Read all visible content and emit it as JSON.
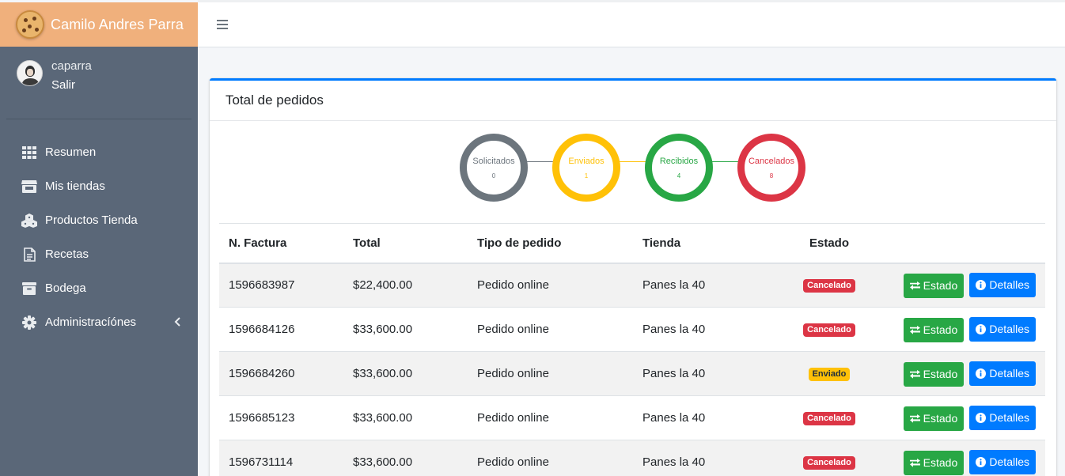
{
  "brand": {
    "name": "Camilo Andres Parra",
    "icon": "cookie-icon"
  },
  "user": {
    "username": "caparra",
    "logout_label": "Salir"
  },
  "nav": {
    "items": [
      {
        "label": "Resumen",
        "icon": "grid-icon"
      },
      {
        "label": "Mis tiendas",
        "icon": "store-icon"
      },
      {
        "label": "Productos Tienda",
        "icon": "cubes-icon"
      },
      {
        "label": "Recetas",
        "icon": "document-icon"
      },
      {
        "label": "Bodega",
        "icon": "archive-icon"
      },
      {
        "label": "Administracíónes",
        "icon": "gear-icon",
        "caret": "chevron-left-icon"
      }
    ]
  },
  "card": {
    "title": "Total de pedidos",
    "steps": [
      {
        "label": "Solicitados",
        "count": "0",
        "color": "#6c757d"
      },
      {
        "label": "Enviados",
        "count": "1",
        "color": "#ffc107"
      },
      {
        "label": "Recibidos",
        "count": "4",
        "color": "#28a745"
      },
      {
        "label": "Cancelados",
        "count": "8",
        "color": "#dc3545"
      }
    ]
  },
  "table": {
    "headers": {
      "factura": "N. Factura",
      "total": "Total",
      "tipo": "Tipo de pedido",
      "tienda": "Tienda",
      "estado": "Estado"
    },
    "action_labels": {
      "estado": "Estado",
      "detalles": "Detalles"
    },
    "rows": [
      {
        "factura": "1596683987",
        "total": "$22,400.00",
        "tipo": "Pedido online",
        "tienda": "Panes la 40",
        "estado": "Cancelado",
        "estado_color": "#dc3545"
      },
      {
        "factura": "1596684126",
        "total": "$33,600.00",
        "tipo": "Pedido online",
        "tienda": "Panes la 40",
        "estado": "Cancelado",
        "estado_color": "#dc3545"
      },
      {
        "factura": "1596684260",
        "total": "$33,600.00",
        "tipo": "Pedido online",
        "tienda": "Panes la 40",
        "estado": "Enviado",
        "estado_color": "#ffc107"
      },
      {
        "factura": "1596685123",
        "total": "$33,600.00",
        "tipo": "Pedido online",
        "tienda": "Panes la 40",
        "estado": "Cancelado",
        "estado_color": "#dc3545"
      },
      {
        "factura": "1596731114",
        "total": "$33,600.00",
        "tipo": "Pedido online",
        "tienda": "Panes la 40",
        "estado": "Cancelado",
        "estado_color": "#dc3545"
      }
    ]
  }
}
